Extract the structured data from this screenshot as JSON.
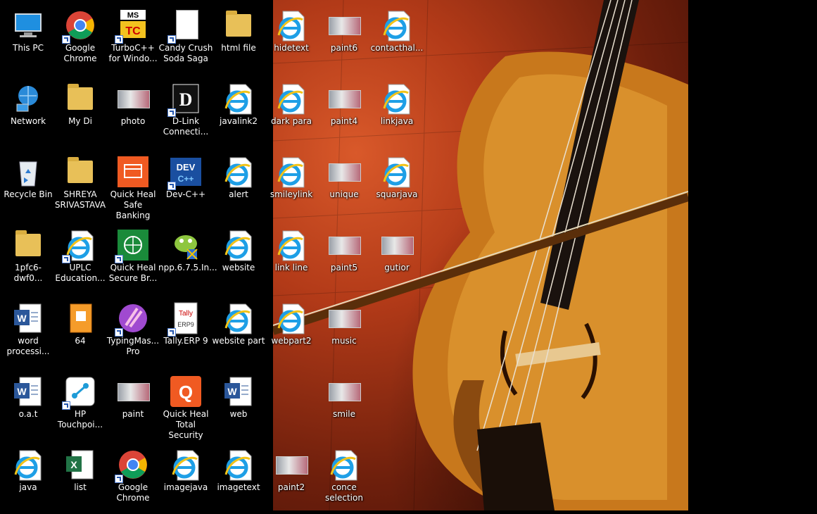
{
  "desktop": {
    "icons": [
      {
        "label": "This PC",
        "glyph": "computer-icon"
      },
      {
        "label": "Network",
        "glyph": "network-icon"
      },
      {
        "label": "Recycle Bin",
        "glyph": "recycle-bin-icon"
      },
      {
        "label": "1pfc6-dwf0...",
        "glyph": "folder-icon"
      },
      {
        "label": "word\nprocessi...",
        "glyph": "word-icon"
      },
      {
        "label": "o.a.t",
        "glyph": "word-icon"
      },
      {
        "label": "java",
        "glyph": "ie-icon"
      },
      {
        "label": "Google\nChrome",
        "glyph": "chrome-icon",
        "shortcut": true
      },
      {
        "label": "My Di",
        "glyph": "folder-icon"
      },
      {
        "label": "SHREYA\nSRIVASTAVA",
        "glyph": "folder-icon"
      },
      {
        "label": "UPLC\nEducation...",
        "glyph": "ie-icon",
        "shortcut": true
      },
      {
        "label": "64",
        "glyph": "orange-app-icon"
      },
      {
        "label": "HP\nTouchpoi...",
        "glyph": "hp-icon",
        "shortcut": true
      },
      {
        "label": "list",
        "glyph": "excel-icon"
      },
      {
        "label": "TurboC++\nfor Windo...",
        "glyph": "turboc-icon",
        "shortcut": true
      },
      {
        "label": "photo",
        "glyph": "image-thumb-icon"
      },
      {
        "label": "Quick Heal\nSafe Banking",
        "glyph": "quickheal-banking-icon"
      },
      {
        "label": "Quick Heal\nSecure Br...",
        "glyph": "quickheal-browser-icon",
        "shortcut": true
      },
      {
        "label": "TypingMas...\nPro",
        "glyph": "typingmaster-icon",
        "shortcut": true
      },
      {
        "label": "paint",
        "glyph": "image-thumb-icon"
      },
      {
        "label": "Google\nChrome",
        "glyph": "chrome-icon",
        "shortcut": true
      },
      {
        "label": "Candy Crush\nSoda Saga",
        "glyph": "blank-doc-icon",
        "shortcut": true
      },
      {
        "label": "D-Link\nConnecti...",
        "glyph": "dlink-icon",
        "shortcut": true
      },
      {
        "label": "Dev-C++",
        "glyph": "devcpp-icon",
        "shortcut": true
      },
      {
        "label": "npp.6.7.5.In...",
        "glyph": "npp-installer-icon"
      },
      {
        "label": "Tally.ERP 9",
        "glyph": "tally-icon",
        "shortcut": true
      },
      {
        "label": "Quick Heal\nTotal Security",
        "glyph": "quickheal-icon"
      },
      {
        "label": "imagejava",
        "glyph": "ie-icon"
      },
      {
        "label": "html file",
        "glyph": "folder-icon"
      },
      {
        "label": "javalink2",
        "glyph": "ie-icon"
      },
      {
        "label": "alert",
        "glyph": "ie-icon"
      },
      {
        "label": "website",
        "glyph": "ie-icon"
      },
      {
        "label": "website part",
        "glyph": "ie-icon"
      },
      {
        "label": "web",
        "glyph": "word-icon"
      },
      {
        "label": "imagetext",
        "glyph": "ie-icon"
      },
      {
        "label": "hidetext",
        "glyph": "ie-icon"
      },
      {
        "label": "dark para",
        "glyph": "ie-icon"
      },
      {
        "label": "smileylink",
        "glyph": "ie-icon"
      },
      {
        "label": "link line",
        "glyph": "ie-icon"
      },
      {
        "label": "webpart2",
        "glyph": "ie-icon"
      },
      {
        "label": "paint2",
        "glyph": "image-thumb-icon"
      },
      {
        "label": "paint6",
        "glyph": "image-thumb-icon"
      },
      {
        "label": "paint4",
        "glyph": "image-thumb-icon"
      },
      {
        "label": "unique",
        "glyph": "image-thumb-icon"
      },
      {
        "label": "paint5",
        "glyph": "image-thumb-icon"
      },
      {
        "label": "music",
        "glyph": "image-thumb-icon"
      },
      {
        "label": "smile",
        "glyph": "image-thumb-icon"
      },
      {
        "label": "conce\nselection",
        "glyph": "ie-icon"
      },
      {
        "label": "contacthal...",
        "glyph": "ie-icon"
      },
      {
        "label": "linkjava",
        "glyph": "ie-icon"
      },
      {
        "label": "squarjava",
        "glyph": "ie-icon"
      },
      {
        "label": "gutior",
        "glyph": "image-thumb-icon"
      }
    ]
  }
}
